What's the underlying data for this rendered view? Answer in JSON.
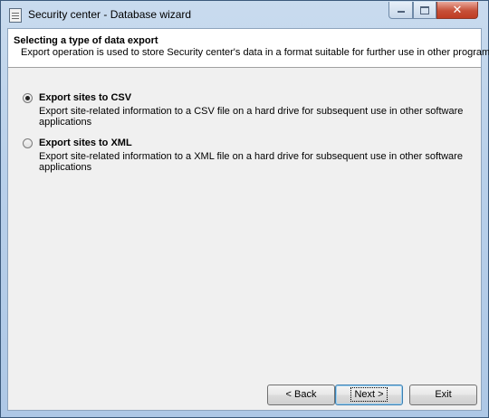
{
  "window": {
    "title": "Security center - Database wizard",
    "close_glyph": "✕",
    "icons": {
      "app": "app-window-icon",
      "minimize": "minimize-icon",
      "maximize": "maximize-icon",
      "close": "close-icon"
    }
  },
  "header": {
    "title": "Selecting a type of data export",
    "description": "Export operation is used to store Security center's data in a format suitable for further use in other programs"
  },
  "options": [
    {
      "label": "Export sites to CSV",
      "description": "Export site-related information to a CSV file on a hard drive for subsequent use in other software applications",
      "selected": true
    },
    {
      "label": "Export sites to XML",
      "description": "Export site-related information to a XML file on a hard drive for subsequent use in other software applications",
      "selected": false
    }
  ],
  "buttons": {
    "back": "< Back",
    "next": "Next >",
    "exit": "Exit"
  }
}
